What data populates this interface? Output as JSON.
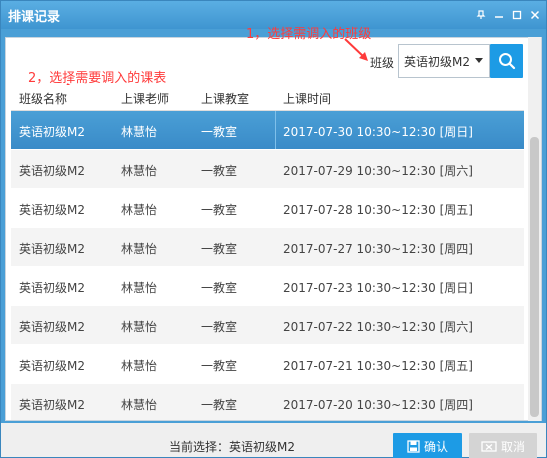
{
  "window": {
    "title": "排课记录"
  },
  "filter": {
    "label": "班级",
    "selected_class": "英语初级M2",
    "search_icon": "search-icon"
  },
  "annotations": {
    "step1": "1，选择需调入的班级",
    "step2": "2，选择需要调入的课表"
  },
  "table": {
    "columns": [
      "班级名称",
      "上课老师",
      "上课教室",
      "上课时间"
    ],
    "rows": [
      [
        "英语初级M2",
        "林慧怡",
        "一教室",
        "2017-07-30 10:30~12:30 [周日]"
      ],
      [
        "英语初级M2",
        "林慧怡",
        "一教室",
        "2017-07-29 10:30~12:30 [周六]"
      ],
      [
        "英语初级M2",
        "林慧怡",
        "一教室",
        "2017-07-28 10:30~12:30 [周五]"
      ],
      [
        "英语初级M2",
        "林慧怡",
        "一教室",
        "2017-07-27 10:30~12:30 [周四]"
      ],
      [
        "英语初级M2",
        "林慧怡",
        "一教室",
        "2017-07-23 10:30~12:30 [周日]"
      ],
      [
        "英语初级M2",
        "林慧怡",
        "一教室",
        "2017-07-22 10:30~12:30 [周六]"
      ],
      [
        "英语初级M2",
        "林慧怡",
        "一教室",
        "2017-07-21 10:30~12:30 [周五]"
      ],
      [
        "英语初级M2",
        "林慧怡",
        "一教室",
        "2017-07-20 10:30~12:30 [周四]"
      ]
    ]
  },
  "footer": {
    "current_selection": "当前选择：英语初级M2",
    "ok_label": "确认",
    "cancel_label": "取消"
  },
  "colors": {
    "accent": "#1d9be5",
    "annotation": "#ff3b3b",
    "selected_row": "#4a9fd6"
  }
}
